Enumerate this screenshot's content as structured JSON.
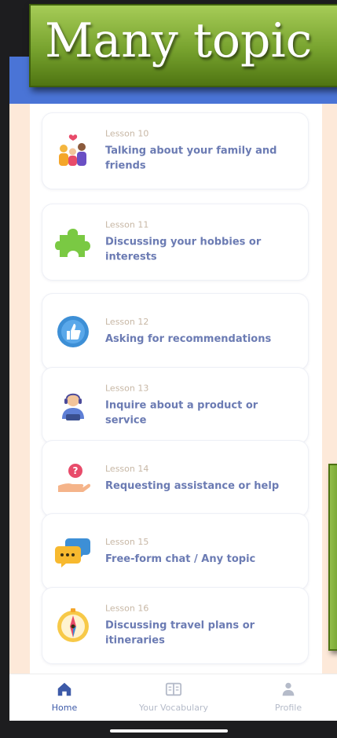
{
  "banner": {
    "text": "Many topic"
  },
  "lessons": [
    {
      "number": "Lesson 10",
      "title": "Talking about your family and friends",
      "icon": "family-icon"
    },
    {
      "number": "Lesson 11",
      "title": "Discussing your hobbies or interests",
      "icon": "puzzle-icon"
    },
    {
      "number": "Lesson 12",
      "title": "Asking for recommendations",
      "icon": "thumbs-up-badge-icon"
    },
    {
      "number": "Lesson 13",
      "title": "Inquire about a product or service",
      "icon": "support-agent-icon"
    },
    {
      "number": "Lesson 14",
      "title": "Requesting assistance or help",
      "icon": "question-hand-icon"
    },
    {
      "number": "Lesson 15",
      "title": "Free-form chat / Any topic",
      "icon": "chat-bubbles-icon"
    },
    {
      "number": "Lesson 16",
      "title": "Discussing travel plans or itineraries",
      "icon": "compass-icon"
    }
  ],
  "bottom_nav": {
    "items": [
      {
        "label": "Home",
        "icon": "home-icon",
        "active": true
      },
      {
        "label": "Your Vocabulary",
        "icon": "book-icon",
        "active": false
      },
      {
        "label": "Profile",
        "icon": "person-icon",
        "active": false
      }
    ]
  },
  "colors": {
    "app_bar": "#4a74d6",
    "content_background": "#fde9d9",
    "lesson_title": "#6b7bb3",
    "lesson_number": "#c7b7a5",
    "nav_active": "#3d5aa8",
    "nav_inactive": "#b5bbc9",
    "banner_green": "#77a22e"
  }
}
